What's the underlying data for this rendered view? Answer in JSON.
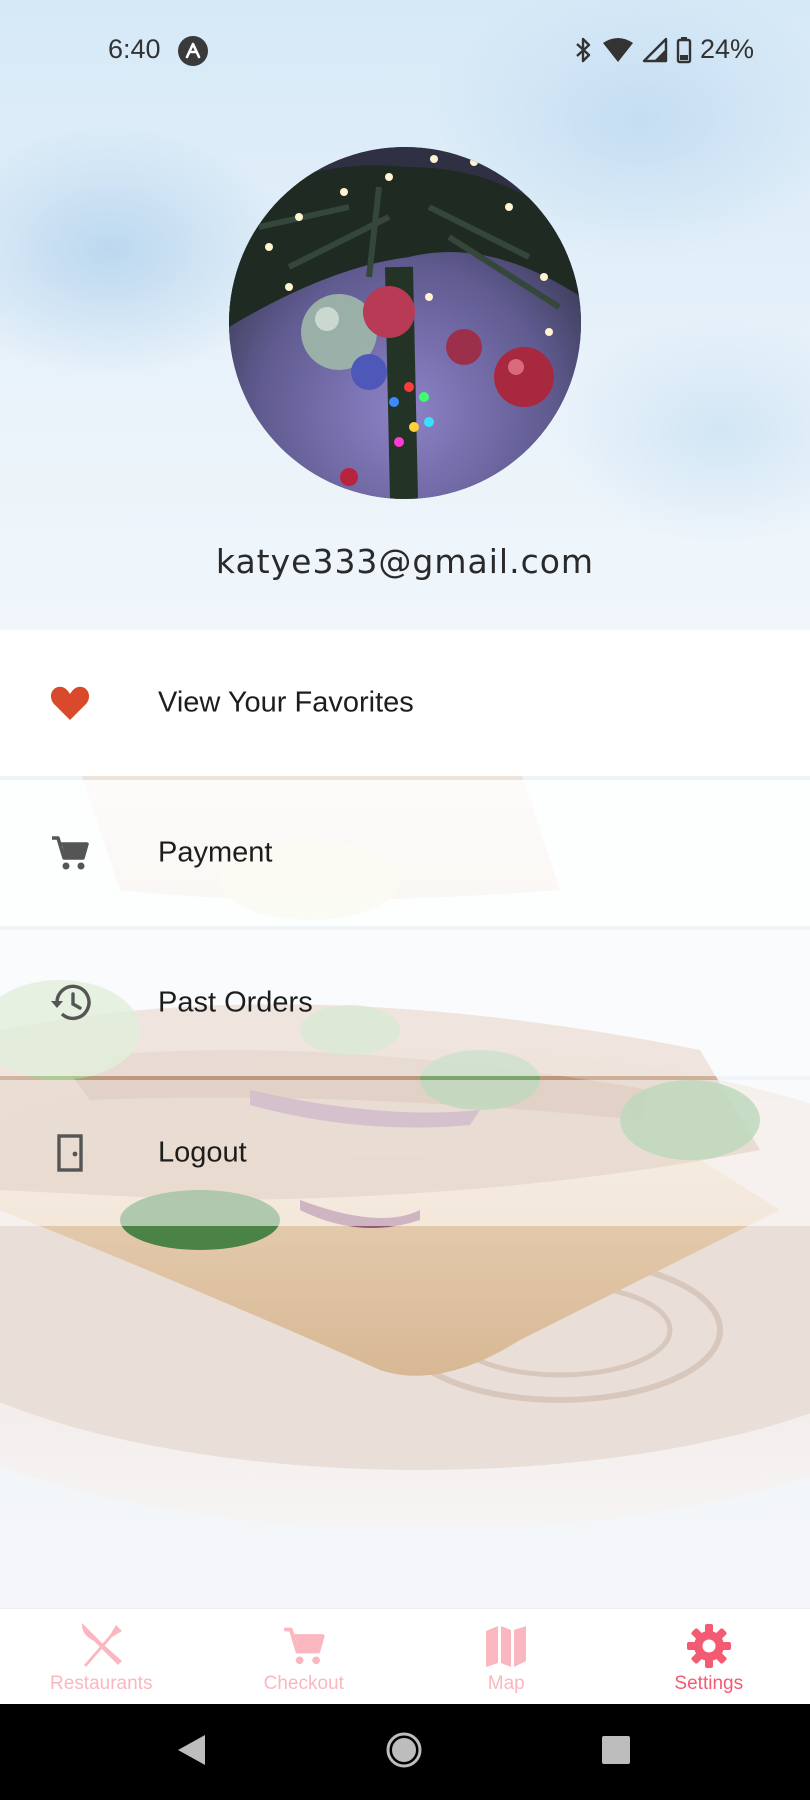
{
  "status_bar": {
    "time": "6:40",
    "battery": "24%"
  },
  "profile": {
    "email": "katye333@gmail.com"
  },
  "menu": {
    "items": [
      {
        "label": "View Your Favorites",
        "icon": "heart-icon"
      },
      {
        "label": "Payment",
        "icon": "cart-icon"
      },
      {
        "label": "Past Orders",
        "icon": "history-icon"
      },
      {
        "label": "Logout",
        "icon": "door-icon"
      }
    ]
  },
  "bottom_nav": {
    "tabs": [
      {
        "label": "Restaurants",
        "icon": "utensils-icon",
        "active": false
      },
      {
        "label": "Checkout",
        "icon": "cart-icon",
        "active": false
      },
      {
        "label": "Map",
        "icon": "map-icon",
        "active": false
      },
      {
        "label": "Settings",
        "icon": "gear-icon",
        "active": true
      }
    ]
  },
  "colors": {
    "accent": "#f45b72",
    "accent_muted": "#fbb7c0",
    "heart": "#d84a2b",
    "icon_gray": "#555555"
  }
}
